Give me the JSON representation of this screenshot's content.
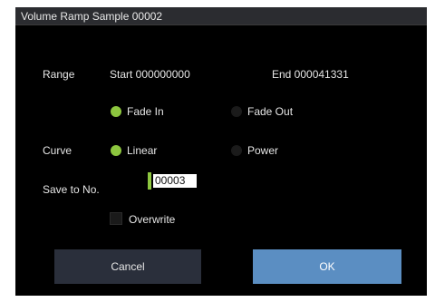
{
  "dialog": {
    "title": "Volume Ramp Sample 00002"
  },
  "range": {
    "label": "Range",
    "start": "Start 000000000",
    "end": "End 000041331"
  },
  "fade": {
    "options": [
      {
        "label": "Fade In",
        "selected": true
      },
      {
        "label": "Fade Out",
        "selected": false
      }
    ]
  },
  "curve": {
    "label": "Curve",
    "options": [
      {
        "label": "Linear",
        "selected": true
      },
      {
        "label": "Power",
        "selected": false
      }
    ]
  },
  "save": {
    "label": "Save to No.",
    "value": "00003"
  },
  "overwrite": {
    "label": "Overwrite",
    "checked": false
  },
  "buttons": {
    "cancel": "Cancel",
    "ok": "OK"
  },
  "colors": {
    "accent_green": "#8dc63f",
    "ok_blue": "#5b8ec2",
    "cancel_bg": "#2a2f3b"
  }
}
